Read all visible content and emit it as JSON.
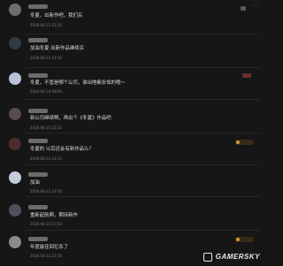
{
  "comments": [
    {
      "text": "冬夏，出新作吧，我们买",
      "time": "2026-04-23 22:32",
      "avatar_color": "#6e6e6e"
    },
    {
      "text": "加油冬夏 出新作品继续买",
      "time": "2026-04-23 11:02",
      "avatar_color": "#2f3a44"
    },
    {
      "text": "冬夏，不管是哪个公司，谁出啥都永恒的哦～",
      "time": "2026-04-24 08:04",
      "avatar_color": "#b9c3d6"
    },
    {
      "text": "新公司继续啊，再出个《冬夏》作品吧",
      "time": "2026-04-23 22:22",
      "avatar_color": "#5a4a54"
    },
    {
      "text": "冬夏的 以后还会有新作品么？",
      "time": "2026-04-23 18:13",
      "avatar_color": "#4a2e2e"
    },
    {
      "text": "加油",
      "time": "2026-04-23 18:10",
      "avatar_color": "#c4ccdc"
    },
    {
      "text": "重新起航啊，期待新作",
      "time": "2026-04-23 13:54",
      "avatar_color": "#4e4e5e"
    },
    {
      "text": "年度最佳回忆杀了",
      "time": "2026-04-22 22:35",
      "avatar_color": "#8a8a8a"
    }
  ],
  "watermark": "GAMERSKY",
  "icons": {
    "more": "more-dots-icon",
    "logo": "gamersky-logo-icon"
  }
}
